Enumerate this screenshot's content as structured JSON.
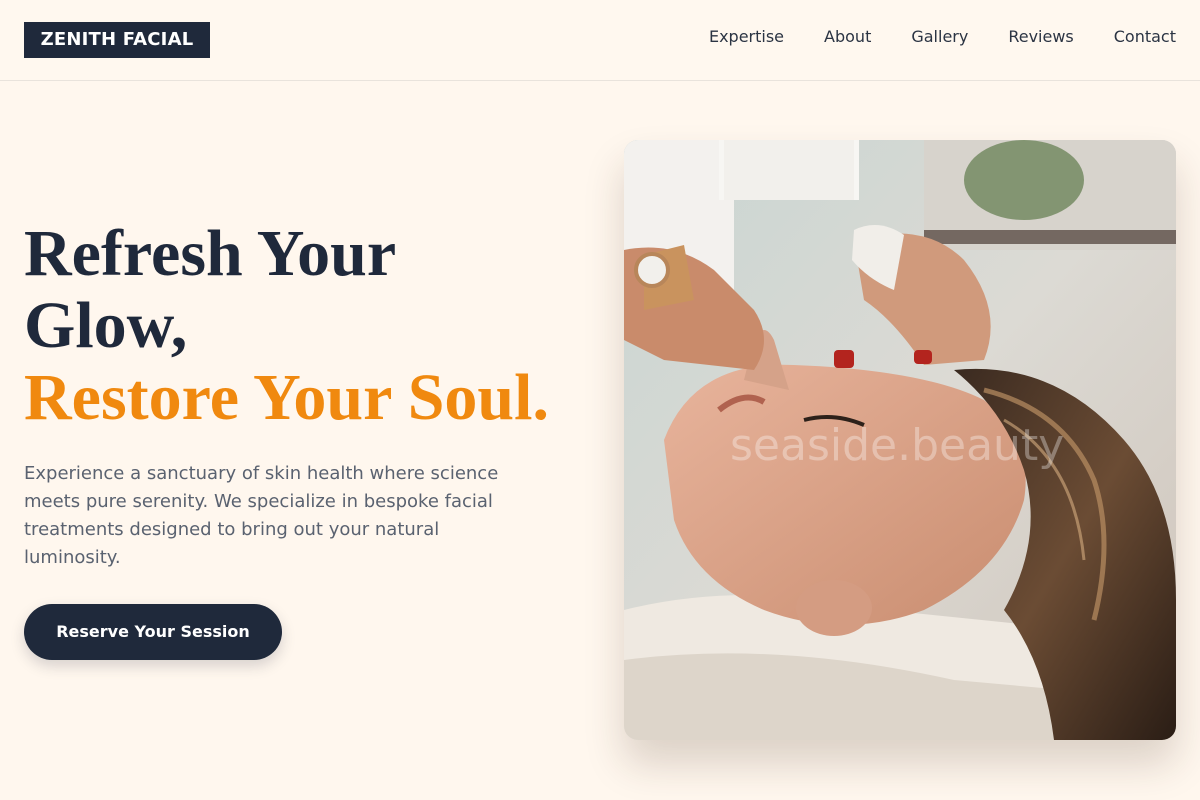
{
  "header": {
    "logo": "ZENITH FACIAL",
    "nav": [
      "Expertise",
      "About",
      "Gallery",
      "Reviews",
      "Contact"
    ]
  },
  "hero": {
    "title_line1": "Refresh Your",
    "title_line2": "Glow,",
    "title_accent": "Restore Your Soul.",
    "description": "Experience a sanctuary of skin health where science meets pure serenity. We specialize in bespoke facial treatments designed to bring out your natural luminosity.",
    "cta_label": "Reserve Your Session"
  },
  "image": {
    "watermark": "seaside.beauty"
  },
  "colors": {
    "background": "#fff7ee",
    "navy": "#1f293b",
    "accent": "#f0890f"
  }
}
